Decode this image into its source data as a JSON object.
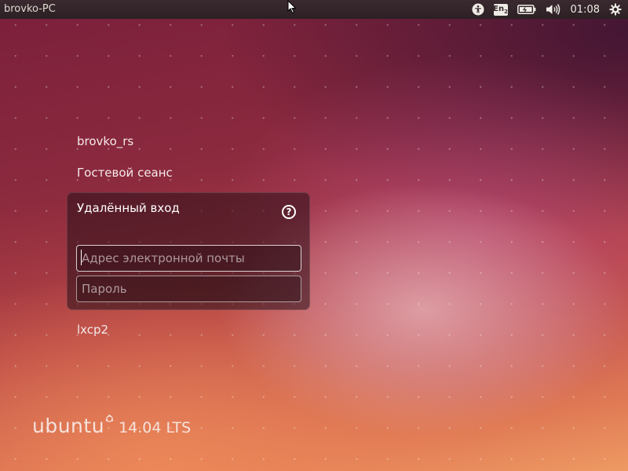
{
  "top_panel": {
    "hostname": "brovko-PC",
    "keyboard_layout": "En",
    "keyboard_layout_sub": "2",
    "clock": "01:08",
    "icons": [
      "accessibility-icon",
      "keyboard-layout-icon",
      "battery-icon",
      "volume-icon",
      "power-icon"
    ]
  },
  "users": [
    {
      "name": "brovko_rs"
    },
    {
      "name": "Гостевой сеанс"
    }
  ],
  "login": {
    "title": "Удалённый вход",
    "help_label": "?",
    "email_placeholder": "Адрес электронной почты",
    "email_value": "",
    "password_placeholder": "Пароль",
    "password_value": ""
  },
  "other_users": [
    {
      "name": "lxcp2"
    }
  ],
  "branding": {
    "word": "ubuntu",
    "version": "14.04 LTS"
  },
  "colors": {
    "panel": "#2c2024",
    "accent_text": "#f3e9ea"
  }
}
